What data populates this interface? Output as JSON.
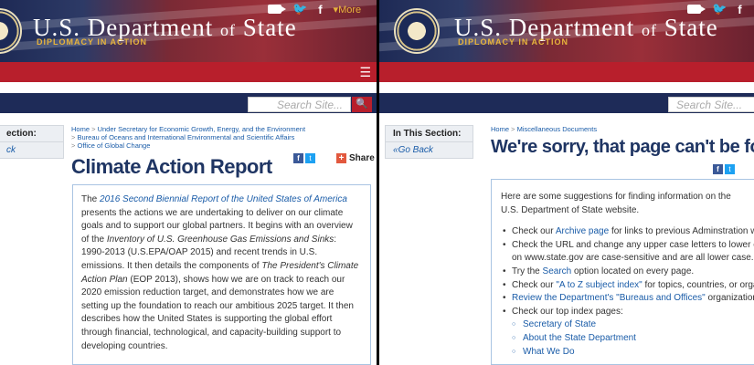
{
  "header": {
    "title_main": "U.S. Department",
    "title_of": "of",
    "title_end": "State",
    "subtitle": "DIPLOMACY IN ACTION",
    "more_label": "More"
  },
  "search": {
    "placeholder": "Search Site...",
    "button_icon": "search-icon"
  },
  "left": {
    "sidebar_heading": "ection:",
    "sidebar_back": "ck",
    "breadcrumbs": [
      "Home",
      "Under Secretary for Economic Growth, Energy, and the Environment",
      "Bureau of Oceans and International Environmental and Scientific Affairs",
      "Office of Global Change"
    ],
    "page_title": "Climate Action Report",
    "share_label": "Share",
    "body": {
      "p1": "The ",
      "link1": "2016 Second Biennial Report of the United States of America",
      "p2": " presents the actions we are undertaking to deliver on our climate goals and to support our global partners. It begins with an overview of the ",
      "i1": "Inventory of U.S. Greenhouse Gas Emissions and Sinks",
      "p3": ": 1990-2013 (U.S.EPA/OAP 2015) and recent trends in U.S. emissions. It then details the components of ",
      "i2": "The President's Climate Action Plan",
      "p4": " (EOP 2013), shows how we are on track to reach our 2020 emission reduction target, and demonstrates how we are setting up the foundation to reach our ambitious 2025 target. It then describes how the United States is supporting the global effort through financial, technological, and capacity-building support to developing countries."
    }
  },
  "right": {
    "sidebar_heading": "In This Section:",
    "sidebar_back": "Go Back",
    "breadcrumbs": [
      "Home",
      "Miscellaneous Documents"
    ],
    "page_title": "We're sorry, that page can't be found.",
    "intro": "Here are some suggestions for finding information on the U.S. Department of State website.",
    "s1_pre": "Check our ",
    "s1_link": "Archive page",
    "s1_post": " for links to previous Adminstration webs",
    "s2_line1": "Check the URL and change any upper case letters to lower case.",
    "s2_line2": "on www.state.gov are case-sensitive and are all lower case.",
    "s3_pre": "Try the ",
    "s3_link": "Search",
    "s3_post": " option located on every page.",
    "s4_pre": "Check our ",
    "s4_link": "\"A to Z subject index\"",
    "s4_post": " for topics, countries, or organiza",
    "s5_link": "Review the Department's \"Bureaus and Offices\"",
    "s5_post": " organizational li",
    "s6": "Check our top index pages:",
    "sub": [
      "Secretary of State",
      "About the State Department",
      "What We Do"
    ]
  }
}
